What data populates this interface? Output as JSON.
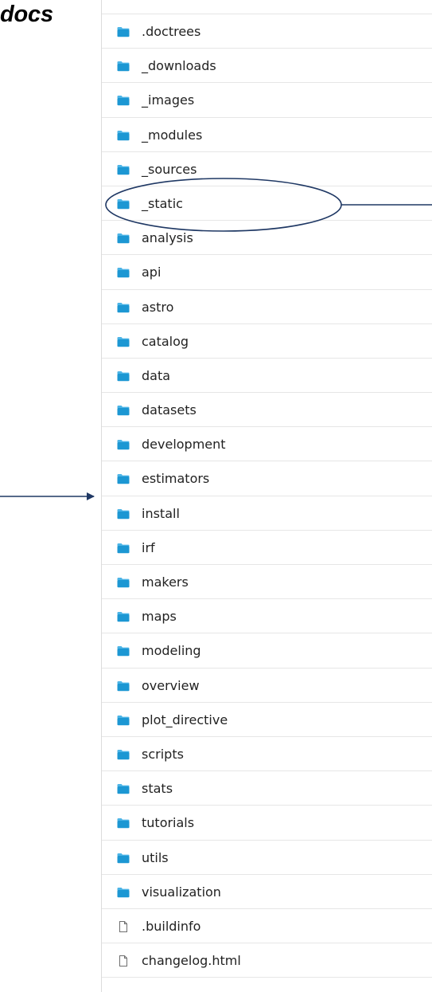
{
  "header": {
    "title": "docs"
  },
  "colors": {
    "folder": "#1c97d3",
    "folder_tab": "#4cb4e6",
    "annotation": "#1f3864",
    "row_divider": "#e6e6e6",
    "text": "#222222"
  },
  "items": [
    {
      "name": ".doctrees",
      "type": "folder",
      "icon": "folder-icon"
    },
    {
      "name": "_downloads",
      "type": "folder",
      "icon": "folder-icon"
    },
    {
      "name": "_images",
      "type": "folder",
      "icon": "folder-icon"
    },
    {
      "name": "_modules",
      "type": "folder",
      "icon": "folder-icon"
    },
    {
      "name": "_sources",
      "type": "folder",
      "icon": "folder-icon"
    },
    {
      "name": "_static",
      "type": "folder",
      "icon": "folder-icon"
    },
    {
      "name": "analysis",
      "type": "folder",
      "icon": "folder-icon"
    },
    {
      "name": "api",
      "type": "folder",
      "icon": "folder-icon"
    },
    {
      "name": "astro",
      "type": "folder",
      "icon": "folder-icon"
    },
    {
      "name": "catalog",
      "type": "folder",
      "icon": "folder-icon"
    },
    {
      "name": "data",
      "type": "folder",
      "icon": "folder-icon"
    },
    {
      "name": "datasets",
      "type": "folder",
      "icon": "folder-icon"
    },
    {
      "name": "development",
      "type": "folder",
      "icon": "folder-icon"
    },
    {
      "name": "estimators",
      "type": "folder",
      "icon": "folder-icon"
    },
    {
      "name": "install",
      "type": "folder",
      "icon": "folder-icon"
    },
    {
      "name": "irf",
      "type": "folder",
      "icon": "folder-icon"
    },
    {
      "name": "makers",
      "type": "folder",
      "icon": "folder-icon"
    },
    {
      "name": "maps",
      "type": "folder",
      "icon": "folder-icon"
    },
    {
      "name": "modeling",
      "type": "folder",
      "icon": "folder-icon"
    },
    {
      "name": "overview",
      "type": "folder",
      "icon": "folder-icon"
    },
    {
      "name": "plot_directive",
      "type": "folder",
      "icon": "folder-icon"
    },
    {
      "name": "scripts",
      "type": "folder",
      "icon": "folder-icon"
    },
    {
      "name": "stats",
      "type": "folder",
      "icon": "folder-icon"
    },
    {
      "name": "tutorials",
      "type": "folder",
      "icon": "folder-icon"
    },
    {
      "name": "utils",
      "type": "folder",
      "icon": "folder-icon"
    },
    {
      "name": "visualization",
      "type": "folder",
      "icon": "folder-icon"
    },
    {
      "name": ".buildinfo",
      "type": "file",
      "icon": "document-icon"
    },
    {
      "name": "changelog.html",
      "type": "file",
      "icon": "document-icon"
    }
  ],
  "annotations": {
    "highlighted_item": "_static",
    "arrow_target_item": "estimators"
  }
}
